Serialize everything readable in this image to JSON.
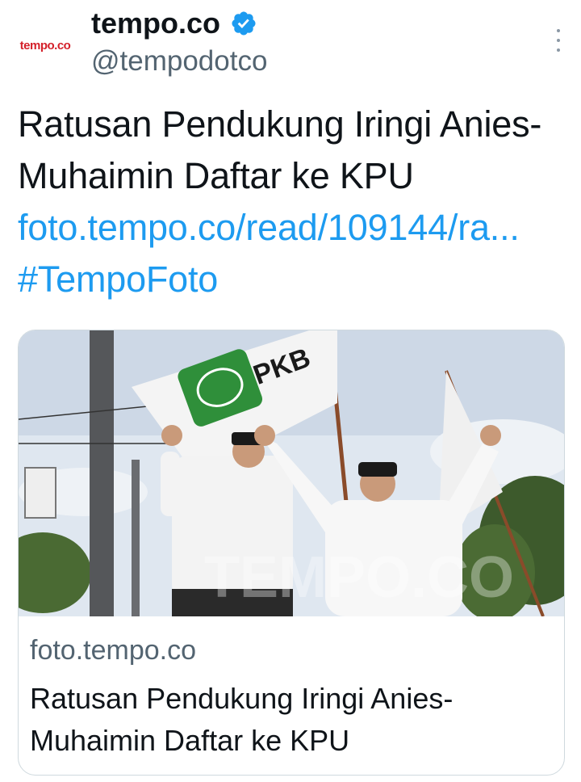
{
  "author": {
    "avatar_text": "tempo.co",
    "display_name": "tempo.co",
    "handle": "@tempodotco",
    "verified_icon": "verified-badge-icon",
    "accent_color": "#1d9bf0"
  },
  "menu": {
    "icon": "more-vertical-icon"
  },
  "tweet": {
    "text": "Ratusan Pendukung Iringi Anies-Muhaimin Daftar ke KPU",
    "link": "foto.tempo.co/read/109144/ra...",
    "hashtag": "#TempoFoto"
  },
  "card": {
    "image_watermark": "TEMPO.CO",
    "flag_text": "PKB",
    "domain": "foto.tempo.co",
    "title": "Ratusan Pendukung Iringi Anies-Muhaimin Daftar ke KPU"
  }
}
